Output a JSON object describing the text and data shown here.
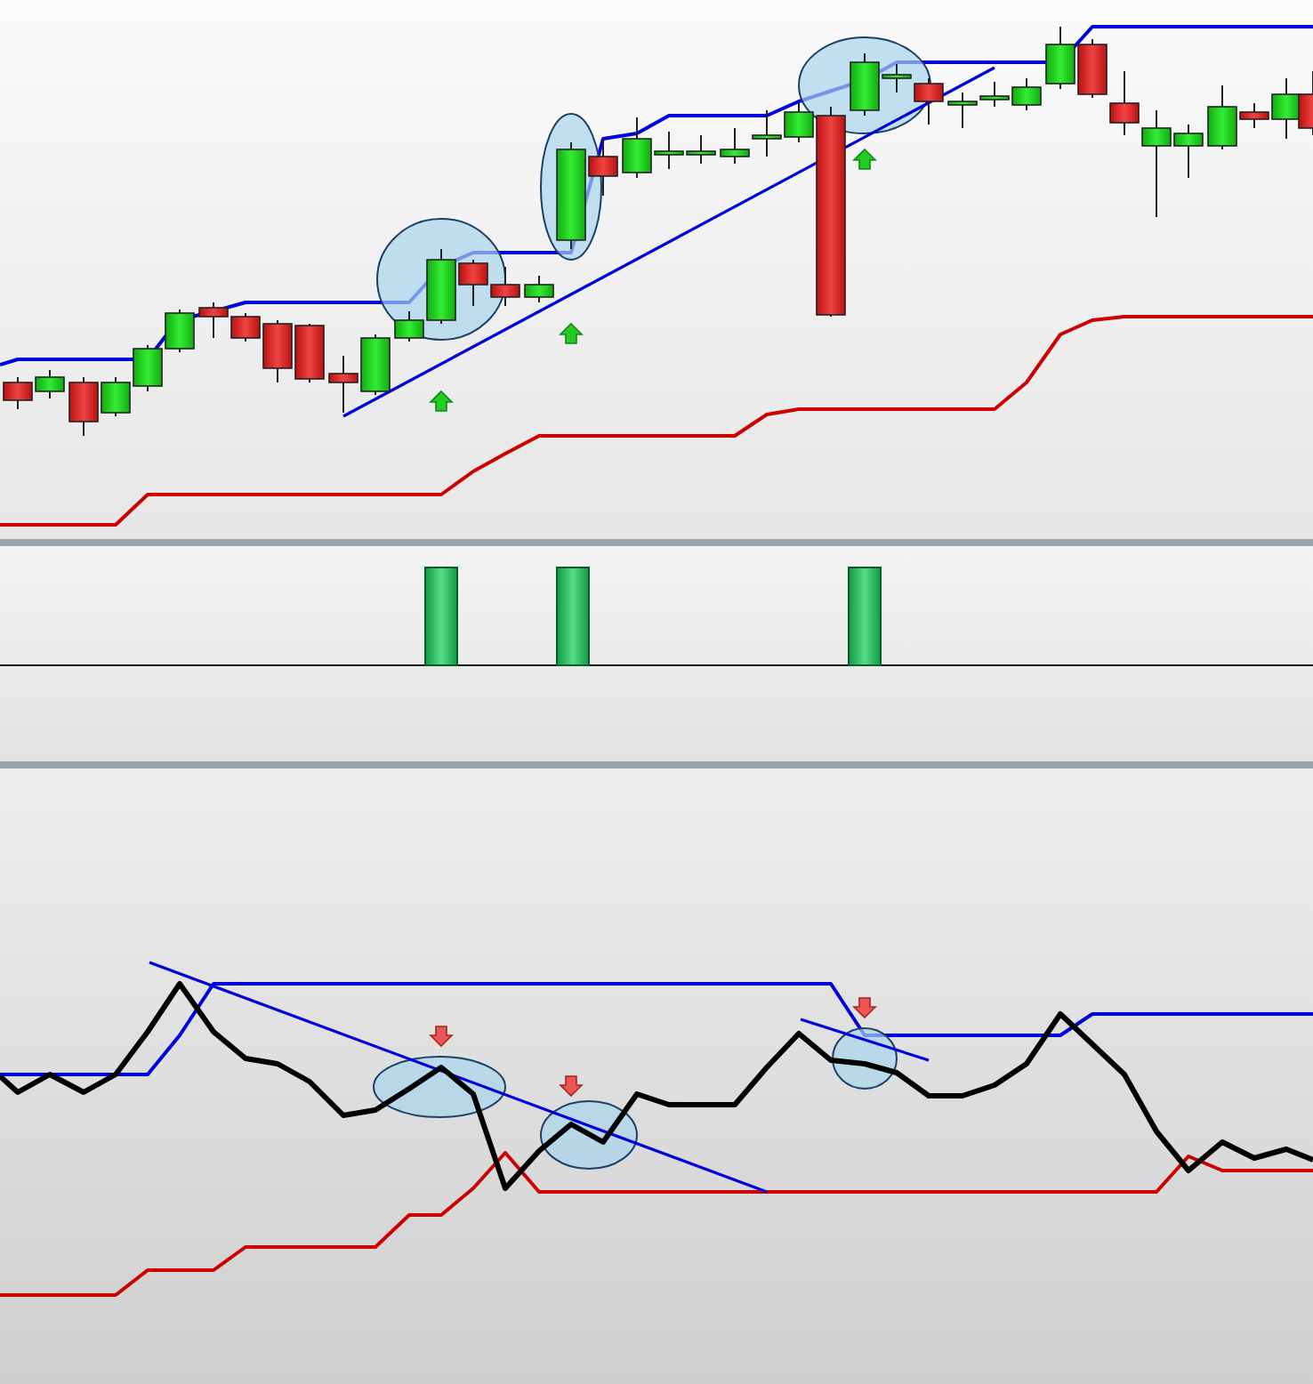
{
  "panes": [
    {
      "kind": "candles"
    },
    {
      "kind": "histogram"
    },
    {
      "kind": "oscillator"
    }
  ]
}
